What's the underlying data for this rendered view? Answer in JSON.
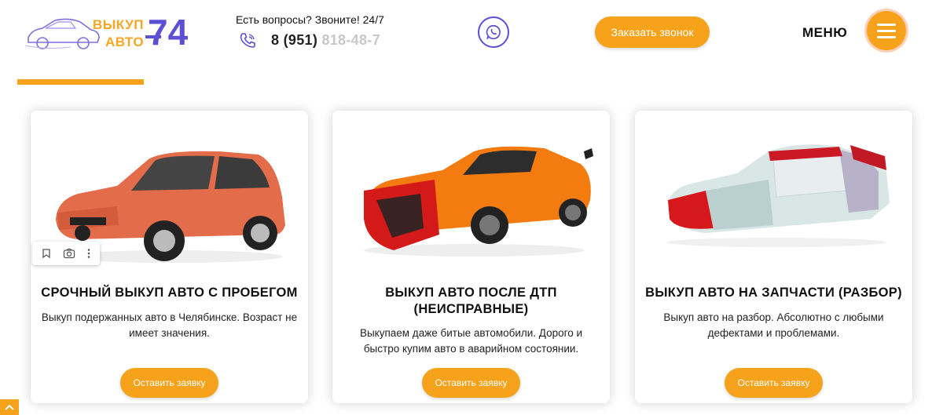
{
  "header": {
    "logo_top": "ВЫКУП",
    "logo_bottom": "АВТО",
    "logo_number": "74",
    "contact_question": "Есть вопросы? Звоните! 24/7",
    "phone_main": "8 (951) ",
    "phone_faded": "818-48-7",
    "callback_label": "Заказать звонок",
    "menu_label": "МЕНЮ"
  },
  "cards": [
    {
      "title": "СРОЧНЫЙ ВЫКУП АВТО С ПРОБЕГОМ",
      "description": "Выкуп подержанных авто в Челябинске. Возраст не имеет значения.",
      "button_label": "Оставить заявку",
      "image": "orange-hatchback-car"
    },
    {
      "title": "ВЫКУП АВТО ПОСЛЕ ДТП (НЕИСПРАВНЫЕ)",
      "description": "Выкупаем даже битые автомобили. Дорого и быстро купим авто в аварийном состоянии.",
      "button_label": "Оставить заявку",
      "image": "damaged-orange-sports-car"
    },
    {
      "title": "ВЫКУП АВТО НА ЗАПЧАСТИ (РАЗБОР)",
      "description": "Выкуп авто на разбор. Абсолютно с любыми дефектами и проблемами.",
      "button_label": "Оставить заявку",
      "image": "disassembled-car-body"
    }
  ],
  "colors": {
    "accent": "#f7a21b",
    "brand_purple": "#5b4fd6"
  }
}
